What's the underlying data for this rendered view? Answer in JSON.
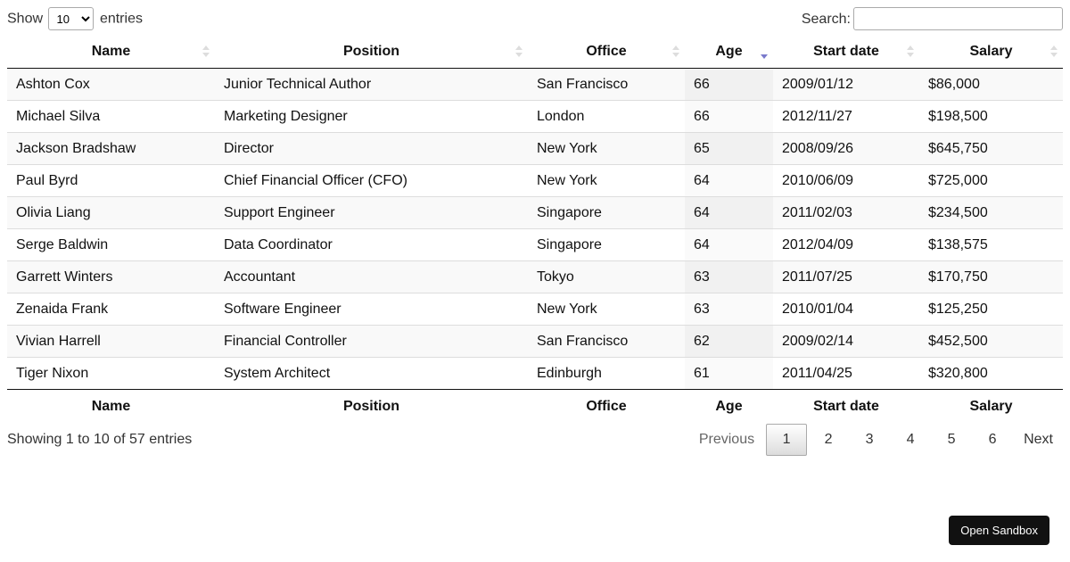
{
  "length_control": {
    "prefix": "Show",
    "value": "10",
    "suffix": "entries"
  },
  "search": {
    "label": "Search:",
    "value": "",
    "placeholder": ""
  },
  "columns": [
    "Name",
    "Position",
    "Office",
    "Age",
    "Start date",
    "Salary"
  ],
  "sort": {
    "column": "Age",
    "direction": "descending",
    "indicator_color": "#7a7acc"
  },
  "rows": [
    [
      "Ashton Cox",
      "Junior Technical Author",
      "San Francisco",
      "66",
      "2009/01/12",
      "$86,000"
    ],
    [
      "Michael Silva",
      "Marketing Designer",
      "London",
      "66",
      "2012/11/27",
      "$198,500"
    ],
    [
      "Jackson Bradshaw",
      "Director",
      "New York",
      "65",
      "2008/09/26",
      "$645,750"
    ],
    [
      "Paul Byrd",
      "Chief Financial Officer (CFO)",
      "New York",
      "64",
      "2010/06/09",
      "$725,000"
    ],
    [
      "Olivia Liang",
      "Support Engineer",
      "Singapore",
      "64",
      "2011/02/03",
      "$234,500"
    ],
    [
      "Serge Baldwin",
      "Data Coordinator",
      "Singapore",
      "64",
      "2012/04/09",
      "$138,575"
    ],
    [
      "Garrett Winters",
      "Accountant",
      "Tokyo",
      "63",
      "2011/07/25",
      "$170,750"
    ],
    [
      "Zenaida Frank",
      "Software Engineer",
      "New York",
      "63",
      "2010/01/04",
      "$125,250"
    ],
    [
      "Vivian Harrell",
      "Financial Controller",
      "San Francisco",
      "62",
      "2009/02/14",
      "$452,500"
    ],
    [
      "Tiger Nixon",
      "System Architect",
      "Edinburgh",
      "61",
      "2011/04/25",
      "$320,800"
    ]
  ],
  "info": "Showing 1 to 10 of 57 entries",
  "pagination": {
    "previous": "Previous",
    "pages": [
      "1",
      "2",
      "3",
      "4",
      "5",
      "6"
    ],
    "current": "1",
    "next": "Next"
  },
  "sandbox_button": "Open Sandbox"
}
